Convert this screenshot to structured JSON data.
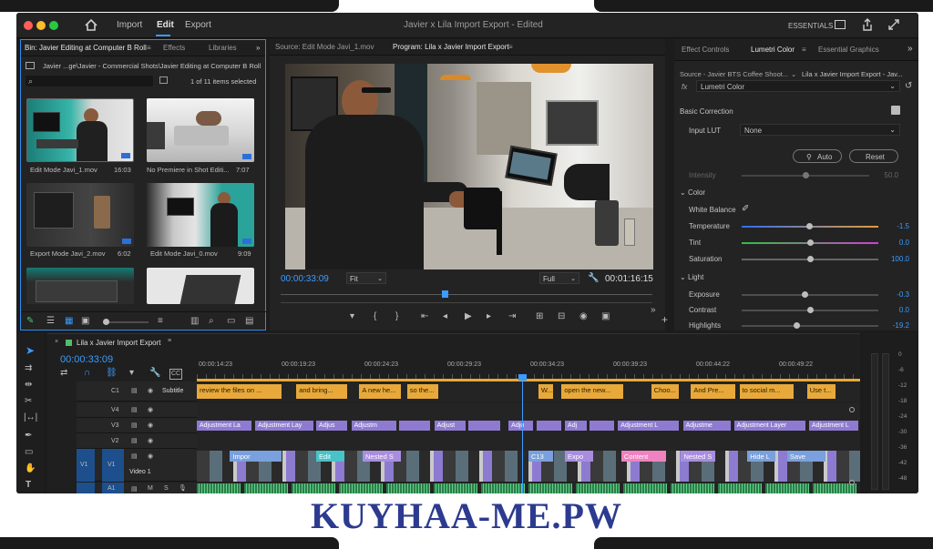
{
  "titlebar": {
    "menu": [
      "Import",
      "Edit",
      "Export"
    ],
    "active_menu": "Edit",
    "project_title": "Javier x Lila Import Export",
    "status": "- Edited",
    "workspace": "ESSENTIALS"
  },
  "bin": {
    "tabs": [
      "Bin: Javier Editing at Computer B Roll",
      "Effects",
      "Libraries"
    ],
    "path": "Javier ...ge\\Javier - Commercial Shots\\Javier Editing at Computer B Roll",
    "search_placeholder": "",
    "count": "1 of 11 items selected",
    "items": [
      {
        "name": "Edit Mode Javi_1.mov",
        "duration": "16:03"
      },
      {
        "name": "No Premiere in Shot Editi...",
        "duration": "7:07"
      },
      {
        "name": "Export Mode Javi_2.mov",
        "duration": "6:02"
      },
      {
        "name": "Edit Mode Javi_0.mov",
        "duration": "9:09"
      },
      {
        "name": "",
        "duration": ""
      },
      {
        "name": "",
        "duration": ""
      }
    ]
  },
  "source": {
    "tab": "Source: Edit Mode Javi_1.mov"
  },
  "program": {
    "tab": "Program: Lila x Javier Import Export",
    "timecode": "00:00:33:09",
    "fit": "Fit",
    "quality": "Full",
    "duration": "00:01:16:15",
    "playhead": 0.44
  },
  "effects": {
    "tabs": [
      "Effect Controls",
      "Lumetri Color",
      "Essential Graphics"
    ],
    "source_line": "Source - Javier BTS Coffee Shoot...",
    "sequence_line": "Lila x Javier Import Export - Jav...",
    "fx_label": "fx",
    "effect": "Lumetri Color",
    "basic_correction": "Basic Correction",
    "input_lut_label": "Input LUT",
    "input_lut_value": "None",
    "auto": "Auto",
    "reset": "Reset",
    "intensity_label": "Intensity",
    "intensity_value": "50.0",
    "intensity_pos": 0.5,
    "color_section": "Color",
    "white_balance": "White Balance",
    "color_sliders": [
      {
        "label": "Temperature",
        "value": "-1.5",
        "pos": 0.49
      },
      {
        "label": "Tint",
        "value": "0.0",
        "pos": 0.5
      },
      {
        "label": "Saturation",
        "value": "100.0",
        "pos": 0.5
      }
    ],
    "light_section": "Light",
    "light_sliders": [
      {
        "label": "Exposure",
        "value": "-0.3",
        "pos": 0.46
      },
      {
        "label": "Contrast",
        "value": "0.0",
        "pos": 0.5
      },
      {
        "label": "Highlights",
        "value": "-19.2",
        "pos": 0.4
      }
    ]
  },
  "timeline": {
    "tab": "Lila x Javier Import Export",
    "timecode": "00:00:33:09",
    "ruler": [
      "00:00:14:23",
      "00:00:19:23",
      "00:00:24:23",
      "00:00:29:23",
      "00:00:34:23",
      "00:00:39:23",
      "00:00:44:22",
      "00:00:49:22"
    ],
    "playhead": 0.49,
    "tracks": [
      "C1",
      "V4",
      "V3",
      "V2",
      "V1",
      "A1"
    ],
    "subtitle_track": "Subtitle",
    "video_track": "Video 1",
    "v1_src": "V1",
    "a1_letters": [
      "M",
      "S"
    ],
    "subtitles": [
      {
        "t": "review the files on ...",
        "x": 0,
        "w": 0.13
      },
      {
        "t": "and bring...",
        "x": 0.15,
        "w": 0.08
      },
      {
        "t": "A new he...",
        "x": 0.245,
        "w": 0.065
      },
      {
        "t": "so the...",
        "x": 0.317,
        "w": 0.05
      },
      {
        "t": "W...",
        "x": 0.515,
        "w": 0.025
      },
      {
        "t": "open the new...",
        "x": 0.55,
        "w": 0.095
      },
      {
        "t": "Choo...",
        "x": 0.685,
        "w": 0.045
      },
      {
        "t": "And Pre...",
        "x": 0.745,
        "w": 0.07
      },
      {
        "t": "to social m...",
        "x": 0.818,
        "w": 0.085
      },
      {
        "t": "Use t...",
        "x": 0.92,
        "w": 0.045
      }
    ],
    "adjustments": [
      {
        "t": "Adjustment La",
        "x": 0,
        "w": 0.085
      },
      {
        "t": "Adjustment Lay",
        "x": 0.088,
        "w": 0.09
      },
      {
        "t": "Adjus",
        "x": 0.18,
        "w": 0.05
      },
      {
        "t": "Adjustm",
        "x": 0.233,
        "w": 0.07
      },
      {
        "t": "",
        "x": 0.305,
        "w": 0.05
      },
      {
        "t": "Adjust",
        "x": 0.358,
        "w": 0.05
      },
      {
        "t": "",
        "x": 0.41,
        "w": 0.05
      },
      {
        "t": "Adju",
        "x": 0.47,
        "w": 0.04
      },
      {
        "t": "",
        "x": 0.512,
        "w": 0.04
      },
      {
        "t": "Adj",
        "x": 0.555,
        "w": 0.035
      },
      {
        "t": "",
        "x": 0.592,
        "w": 0.04
      },
      {
        "t": "Adjustment L",
        "x": 0.635,
        "w": 0.095
      },
      {
        "t": "Adjustme",
        "x": 0.733,
        "w": 0.075
      },
      {
        "t": "Adjustment Layer",
        "x": 0.81,
        "w": 0.11
      },
      {
        "t": "Adjustment L",
        "x": 0.923,
        "w": 0.077
      }
    ],
    "videos": [
      {
        "t": "Impor",
        "x": 0.05,
        "w": 0.08,
        "c": "#7aa0dd"
      },
      {
        "t": "Edit",
        "x": 0.18,
        "w": 0.045,
        "c": "#48c3c8"
      },
      {
        "t": "Nested S",
        "x": 0.25,
        "w": 0.06,
        "c": "#a88de0"
      },
      {
        "t": "C13",
        "x": 0.5,
        "w": 0.04,
        "c": "#7aa0dd"
      },
      {
        "t": "Expo",
        "x": 0.555,
        "w": 0.045,
        "c": "#a88de0"
      },
      {
        "t": "Content",
        "x": 0.64,
        "w": 0.07,
        "c": "#ef82c0"
      },
      {
        "t": "Nested S",
        "x": 0.73,
        "w": 0.055,
        "c": "#a88de0"
      },
      {
        "t": "Hide L",
        "x": 0.83,
        "w": 0.045,
        "c": "#7aa0dd"
      },
      {
        "t": "Save",
        "x": 0.89,
        "w": 0.06,
        "c": "#7aa0dd"
      }
    ],
    "meter": [
      "0",
      "-6",
      "-12",
      "-18",
      "-24",
      "-30",
      "-36",
      "-42",
      "-48"
    ]
  },
  "watermark": "KUYHAA-ME.PW"
}
